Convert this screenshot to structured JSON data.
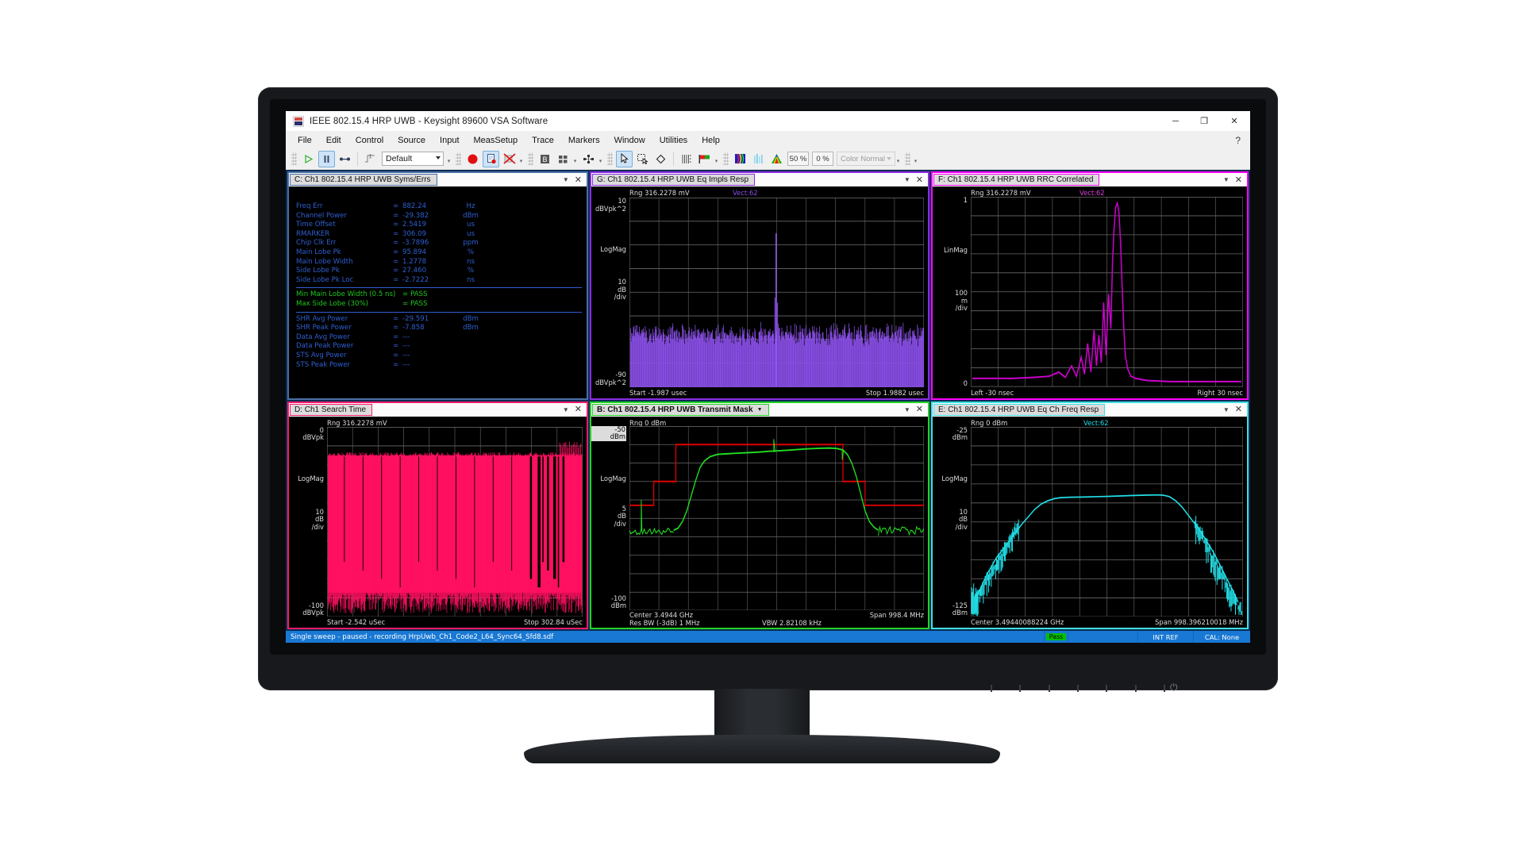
{
  "window": {
    "title": "IEEE 802.15.4 HRP UWB - Keysight 89600 VSA Software",
    "minimize": "─",
    "maximize": "❐",
    "close": "✕",
    "help_glyph": "?"
  },
  "menu": {
    "items": [
      "File",
      "Edit",
      "Control",
      "Source",
      "Input",
      "MeasSetup",
      "Trace",
      "Markers",
      "Window",
      "Utilities",
      "Help"
    ]
  },
  "toolbar": {
    "play_icon": "play-icon",
    "pause_icon": "pause-icon",
    "step_icon": "step-icon",
    "trigger_icon": "trigger-icon",
    "preset_value": "Default",
    "record_icon": "record-icon",
    "recording_icon": "recording-file-icon",
    "stop_record_icon": "stop-recording-icon",
    "bold_icon": "b-icon",
    "layout_icon": "grid-layout-icon",
    "markers_icon": "markers-icon",
    "pointer_icon": "pointer-icon",
    "zoom_box_icon": "zoom-box-icon",
    "marker_diamond_icon": "marker-diamond-icon",
    "spectrogram_icon": "spectrogram-icon",
    "flag_icon": "flag-icon",
    "color_map_icon": "color-map-icon",
    "waterfall_icon": "waterfall-icon",
    "persistence_icon": "persistence-icon",
    "percent_a": "50 %",
    "percent_b": "0 %",
    "color_mode": "Color Normal"
  },
  "panels": {
    "c": {
      "title": "C: Ch1 802.15.4 HRP UWB Syms/Errs",
      "border_color": "#4a6fa5",
      "rows": [
        {
          "label": "Freq Err",
          "eq": "=",
          "value": "882.24",
          "unit": "Hz"
        },
        {
          "label": "Channel Power",
          "eq": "=",
          "value": "-29.382",
          "unit": "dBm"
        },
        {
          "label": "Time Offset",
          "eq": "=",
          "value": "2.5419",
          "unit": "us"
        },
        {
          "label": "RMARKER",
          "eq": "=",
          "value": "306.09",
          "unit": "us"
        },
        {
          "label": "Chip Clk Err",
          "eq": "=",
          "value": "-3.7896",
          "unit": "ppm"
        },
        {
          "label": "Main Lobe Pk",
          "eq": "=",
          "value": "95.894",
          "unit": "%"
        },
        {
          "label": "Main Lobe Width",
          "eq": "=",
          "value": "1.2778",
          "unit": "ns"
        },
        {
          "label": "Side Lobe Pk",
          "eq": "=",
          "value": "27.460",
          "unit": "%"
        },
        {
          "label": "Side Lobe Pk Loc",
          "eq": "=",
          "value": "-2.7222",
          "unit": "ns"
        }
      ],
      "pass_rows": [
        {
          "label": "Min Main Lobe Width (0.5 ns)",
          "eq": "=",
          "value": "PASS"
        },
        {
          "label": "Max Side Lobe (30%)",
          "eq": "=",
          "value": "PASS"
        }
      ],
      "power_rows": [
        {
          "label": "SHR Avg Power",
          "eq": "=",
          "value": "-29.591",
          "unit": "dBm"
        },
        {
          "label": "SHR Peak Power",
          "eq": "=",
          "value": "-7.858",
          "unit": "dBm"
        },
        {
          "label": "Data Avg Power",
          "eq": "=",
          "value": "---",
          "unit": ""
        },
        {
          "label": "Data Peak Power",
          "eq": "=",
          "value": "---",
          "unit": ""
        },
        {
          "label": "STS Avg Power",
          "eq": "=",
          "value": "---",
          "unit": ""
        },
        {
          "label": "STS Peak Power",
          "eq": "=",
          "value": "---",
          "unit": ""
        }
      ]
    },
    "g": {
      "title": "G: Ch1 802.15.4 HRP UWB Eq Impls Resp",
      "border_color": "#8a2be2",
      "trace_color": "#8a4fe8",
      "range": "Rng 316.2278 mV",
      "vect": "Vect:62",
      "y_top": "10\ndBVpk^2",
      "y_mid": "LogMag",
      "y_div": "10\ndB\n/div",
      "y_bot": "-90\ndBVpk^2",
      "x_left": "Start -1.987 usec",
      "x_right": "Stop 1.9882 usec"
    },
    "f": {
      "title": "F: Ch1 802.15.4 HRP UWB RRC Correlated",
      "border_color": "#ff00ff",
      "trace_color": "#cc00cc",
      "range": "Rng 316.2278 mV",
      "vect": "Vect:62",
      "y_top": "1",
      "y_mid": "LinMag",
      "y_div": "100\nm\n/div",
      "y_bot": "0",
      "x_left": "Left -30 nsec",
      "x_right": "Right 30 nsec"
    },
    "d": {
      "title": "D: Ch1 Search Time",
      "border_color": "#ff1a6b",
      "trace_color": "#ff1060",
      "range": "Rng 316.2278 mV",
      "y_top": "0\ndBVpk",
      "y_mid": "LogMag",
      "y_div": "10\ndB\n/div",
      "y_bot": "-100\ndBVpk",
      "x_left": "Start -2.542 uSec",
      "x_right": "Stop 302.84 uSec"
    },
    "b": {
      "title": "B: Ch1 802.15.4 HRP UWB Transmit Mask",
      "border_color": "#22d522",
      "trace_color": "#22dd22",
      "mask_color": "#dd0000",
      "range": "Rng 0 dBm",
      "y_top": "-50\ndBm",
      "y_mid": "LogMag",
      "y_div": "5\ndB\n/div",
      "y_bot": "-100\ndBm",
      "x_left": "Center 3.4944 GHz",
      "x_right": "Span 998.4 MHz",
      "x_left2": "Res BW (-3dB) 1 MHz",
      "x_center2": "VBW 2.82108 kHz"
    },
    "e": {
      "title": "E: Ch1 802.15.4 HRP UWB Eq Ch Freq Resp",
      "border_color": "#3fe0e0",
      "trace_color": "#22e0e8",
      "range": "Rng 0 dBm",
      "vect": "Vect:62",
      "y_top": "-25\ndBm",
      "y_mid": "LogMag",
      "y_div": "10\ndB\n/div",
      "y_bot": "-125\ndBm",
      "x_left": "Center 3.49440088224 GHz",
      "x_right": "Span 998.396210018 MHz"
    }
  },
  "status_bar": {
    "message": "Single sweep - paused - recording HrpUwb_Ch1_Code2_L64_Sync64_Sfd8.sdf",
    "pass": "Pass",
    "ref": "INT REF",
    "cal": "CAL: None"
  }
}
